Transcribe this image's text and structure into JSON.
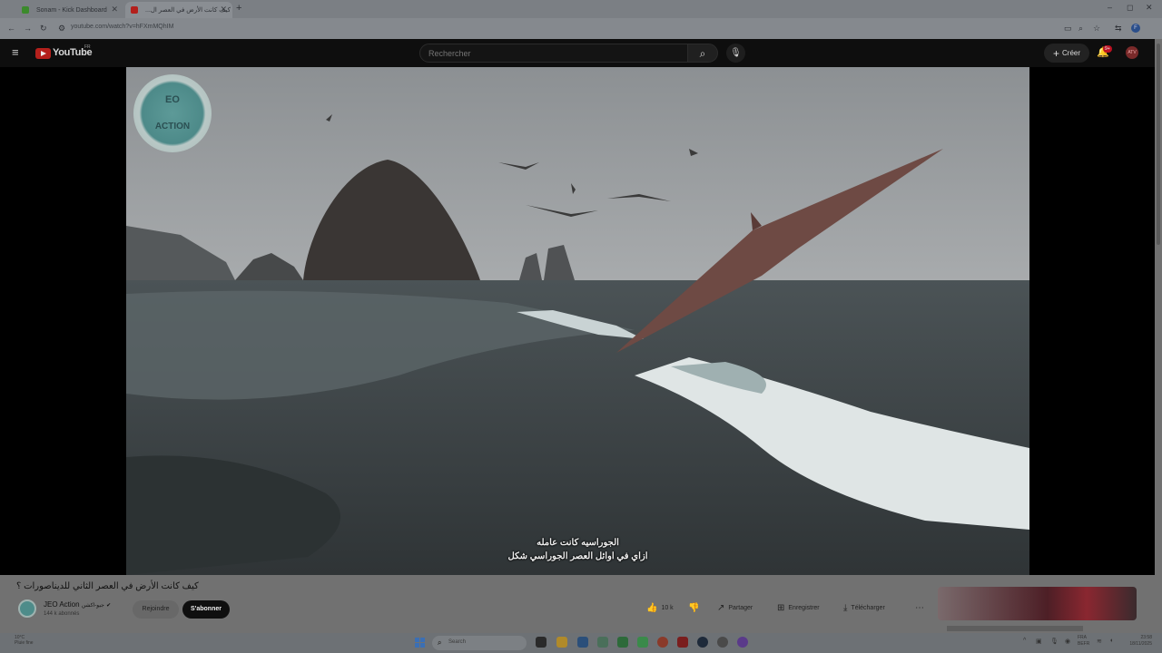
{
  "browser": {
    "tabs": [
      {
        "title": "Sonam - Kick Dashboard",
        "favicon_color": "#3c8a2c"
      },
      {
        "title": "كيف كانت الأرض في العصر ال...",
        "favicon_color": "#b3201c"
      }
    ],
    "new_tab": "+",
    "url": "youtube.com/watch?v=hFXmMQhIM",
    "window_controls": [
      "–",
      "◻",
      "✕"
    ]
  },
  "youtube": {
    "logo_text": "YouTube",
    "region": "FR",
    "search_placeholder": "Rechercher",
    "create_label": "Créer",
    "notif_badge": "9+",
    "avatar_text": "ATV"
  },
  "video": {
    "channel_watermark_top": "EO",
    "channel_watermark_bottom": "ACTION",
    "subtitle_line1": "الجوراسيه كانت عامله",
    "subtitle_line2": "ازاي في اوائل العصر الجوراسي شكل"
  },
  "info": {
    "title": "كيف كانت الأرض في العصر الثاني للديناصورات ؟",
    "channel_name": "JEO Action",
    "channel_suffix": "جيو-اكشن",
    "subscribers": "144 k abonnés",
    "join_label": "Rejoindre",
    "subscribe_label": "S'abonner",
    "likes": "10 k",
    "share_label": "Partager",
    "save_label": "Enregistrer",
    "download_label": "Télécharger",
    "more": "⋯"
  },
  "taskbar": {
    "weather_temp": "10°C",
    "weather_desc": "Pluie fine",
    "search_placeholder": "Search",
    "lang": "FRA",
    "lang_sub": "BEFR",
    "time": "23:58",
    "date": "18/11/2025"
  }
}
